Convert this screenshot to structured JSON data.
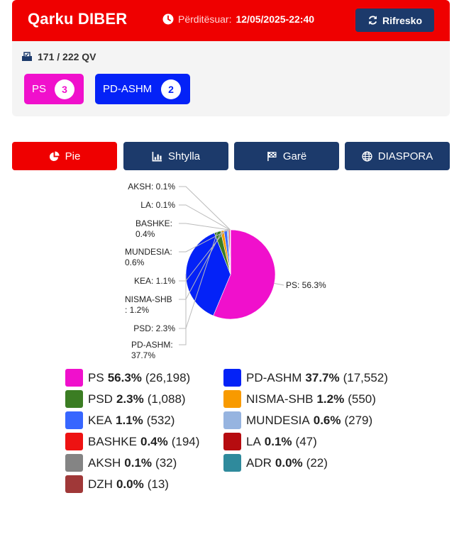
{
  "header": {
    "title": "Qarku DIBER",
    "updated_label": "Përditësuar:",
    "updated_time": "12/05/2025-22:40",
    "refresh_label": "Rifresko"
  },
  "summary": {
    "qv_text": "171 / 222 QV",
    "seats": [
      {
        "party": "PS",
        "count": "3",
        "color": "#f010cc"
      },
      {
        "party": "PD-ASHM",
        "count": "2",
        "color": "#0422f7"
      }
    ]
  },
  "tabs": [
    {
      "label": "Pie",
      "icon": "pie-chart-icon",
      "active": true
    },
    {
      "label": "Shtylla",
      "icon": "bar-chart-icon",
      "active": false
    },
    {
      "label": "Garë",
      "icon": "race-flag-icon",
      "active": false
    },
    {
      "label": "DIASPORA",
      "icon": "globe-icon",
      "active": false
    }
  ],
  "chart_data": {
    "type": "pie",
    "slices": [
      {
        "name": "PS",
        "pct": 56.3,
        "votes": 26198,
        "color": "#f010cc",
        "pct_text": "56.3%",
        "votes_text": "(26,198)",
        "label": "PS: 56.3%"
      },
      {
        "name": "PD-ASHM",
        "pct": 37.7,
        "votes": 17552,
        "color": "#0422f7",
        "pct_text": "37.7%",
        "votes_text": "(17,552)",
        "label": "PD-ASHM: 37.7%"
      },
      {
        "name": "PSD",
        "pct": 2.3,
        "votes": 1088,
        "color": "#3b7d23",
        "pct_text": "2.3%",
        "votes_text": "(1,088)",
        "label": "PSD: 2.3%"
      },
      {
        "name": "NISMA-SHB",
        "pct": 1.2,
        "votes": 550,
        "color": "#f89a00",
        "pct_text": "1.2%",
        "votes_text": "(550)",
        "label": "NISMA-SHB: 1.2%"
      },
      {
        "name": "KEA",
        "pct": 1.1,
        "votes": 532,
        "color": "#3766ff",
        "pct_text": "1.1%",
        "votes_text": "(532)",
        "label": "KEA: 1.1%"
      },
      {
        "name": "MUNDESIA",
        "pct": 0.6,
        "votes": 279,
        "color": "#96b4e0",
        "pct_text": "0.6%",
        "votes_text": "(279)",
        "label": "MUNDESIA: 0.6%"
      },
      {
        "name": "BASHKE",
        "pct": 0.4,
        "votes": 194,
        "color": "#ee1212",
        "pct_text": "0.4%",
        "votes_text": "(194)",
        "label": "BASHKE: 0.4%"
      },
      {
        "name": "LA",
        "pct": 0.1,
        "votes": 47,
        "color": "#b60c10",
        "pct_text": "0.1%",
        "votes_text": "(47)",
        "label": "LA: 0.1%"
      },
      {
        "name": "AKSH",
        "pct": 0.1,
        "votes": 32,
        "color": "#848484",
        "pct_text": "0.1%",
        "votes_text": "(32)",
        "label": "AKSH: 0.1%"
      },
      {
        "name": "ADR",
        "pct": 0.0,
        "votes": 22,
        "color": "#2f8a9c",
        "pct_text": "0.0%",
        "votes_text": "(22)",
        "label": ""
      },
      {
        "name": "DZH",
        "pct": 0.0,
        "votes": 13,
        "color": "#a03838",
        "pct_text": "0.0%",
        "votes_text": "(13)",
        "label": ""
      }
    ]
  }
}
